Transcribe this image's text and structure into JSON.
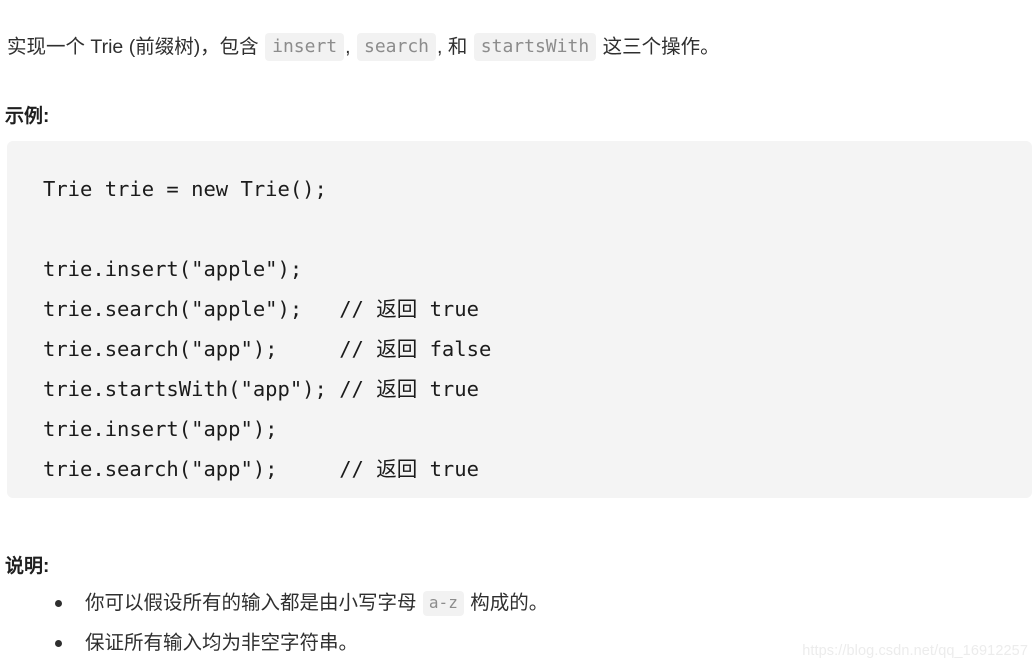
{
  "intro": {
    "prefix": "实现一个 Trie (前缀树)，包含 ",
    "code1": "insert",
    "sep1": ", ",
    "code2": "search",
    "sep2": ", 和 ",
    "code3": "startsWith",
    "suffix": " 这三个操作。"
  },
  "headings": {
    "example": "示例:",
    "note": "说明:"
  },
  "code_block": {
    "language": "java",
    "lines": [
      "Trie trie = new Trie();",
      "",
      "trie.insert(\"apple\");",
      "trie.search(\"apple\");   // 返回 true",
      "trie.search(\"app\");     // 返回 false",
      "trie.startsWith(\"app\"); // 返回 true",
      "trie.insert(\"app\");",
      "trie.search(\"app\");     // 返回 true"
    ],
    "text": "Trie trie = new Trie();\n\ntrie.insert(\"apple\");\ntrie.search(\"apple\");   // 返回 true\ntrie.search(\"app\");     // 返回 false\ntrie.startsWith(\"app\"); // 返回 true\ntrie.insert(\"app\");\ntrie.search(\"app\");     // 返回 true"
  },
  "notes": [
    {
      "prefix": "你可以假设所有的输入都是由小写字母 ",
      "code": "a-z",
      "suffix": " 构成的。"
    },
    {
      "prefix": "保证所有输入均为非空字符串。",
      "code": "",
      "suffix": ""
    }
  ],
  "watermark": "https://blog.csdn.net/qq_16912257",
  "colors": {
    "page_background": "#ffffff",
    "code_block_background": "#f4f4f4",
    "inline_chip_background": "#f2f2f2",
    "inline_chip_text": "#8c8c8c",
    "body_text": "#2f2f2f",
    "heading_text": "#1f1f1f",
    "watermark_text": "#ececec"
  }
}
